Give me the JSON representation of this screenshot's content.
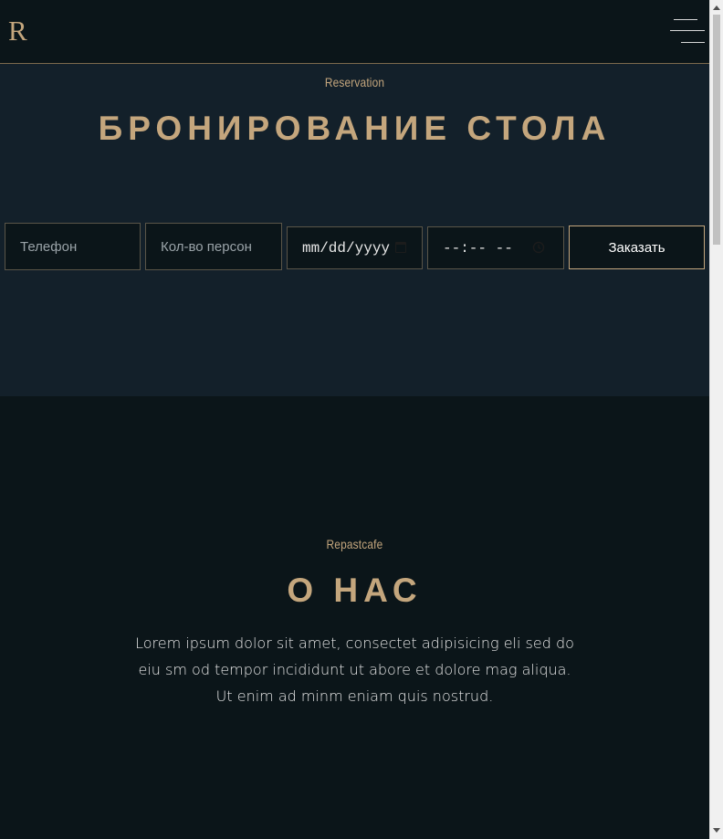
{
  "header": {
    "logo": "R",
    "menu_icon": "hamburger-menu-icon"
  },
  "reservation": {
    "eyebrow": "Reservation",
    "title": "БРОНИРОВАНИЕ СТОЛА",
    "form": {
      "phone_placeholder": "Телефон",
      "guests_placeholder": "Кол-во персон",
      "date_value": "mm/dd/yyyy",
      "time_value": "--:-- --",
      "submit_label": "Заказать",
      "date_icon": "calendar-icon",
      "time_icon": "clock-icon"
    }
  },
  "about": {
    "eyebrow": "Repastcafe",
    "title": "О НАС",
    "text": "Lorem ipsum dolor sit amet, consectet adipisicing eli sed do eiu sm od tempor incididunt ut abore et dolore mag aliqua. Ut enim ad minm eniam quis nostrud."
  },
  "colors": {
    "accent": "#c4a67d",
    "background_dark": "#0b1519",
    "background_section": "#13202a"
  }
}
